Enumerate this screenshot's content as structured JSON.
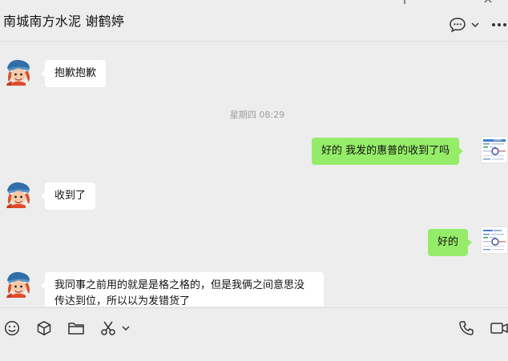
{
  "header": {
    "title": "南城南方水泥 谢鹤婷",
    "icons": [
      "pin-icon",
      "minimize-icon",
      "close-icon",
      "chat-bubble-icon",
      "chevron-down-icon",
      "more-icon"
    ]
  },
  "conversation": {
    "timestamp": "星期四 08:29",
    "messages": [
      {
        "side": "incoming",
        "text": "抱歉抱歉"
      },
      {
        "side": "outgoing",
        "text": "好的 我发的惠普的收到了吗"
      },
      {
        "side": "incoming",
        "text": "收到了"
      },
      {
        "side": "outgoing",
        "text": "好的"
      },
      {
        "side": "incoming",
        "text": "我同事之前用的就是是格之格的，但是我俩之间意思没传达到位，所以以为发错货了"
      }
    ]
  },
  "toolbar": {
    "left_icons": [
      "emoji-icon",
      "package-icon",
      "folder-icon",
      "scissors-icon",
      "chevron-down-icon"
    ],
    "right_icons": [
      "phone-icon",
      "video-call-icon"
    ]
  },
  "colors": {
    "background": "#ededed",
    "incoming_bubble": "#ffffff",
    "outgoing_bubble": "#95ec69",
    "timestamp": "#9d9d9d"
  }
}
